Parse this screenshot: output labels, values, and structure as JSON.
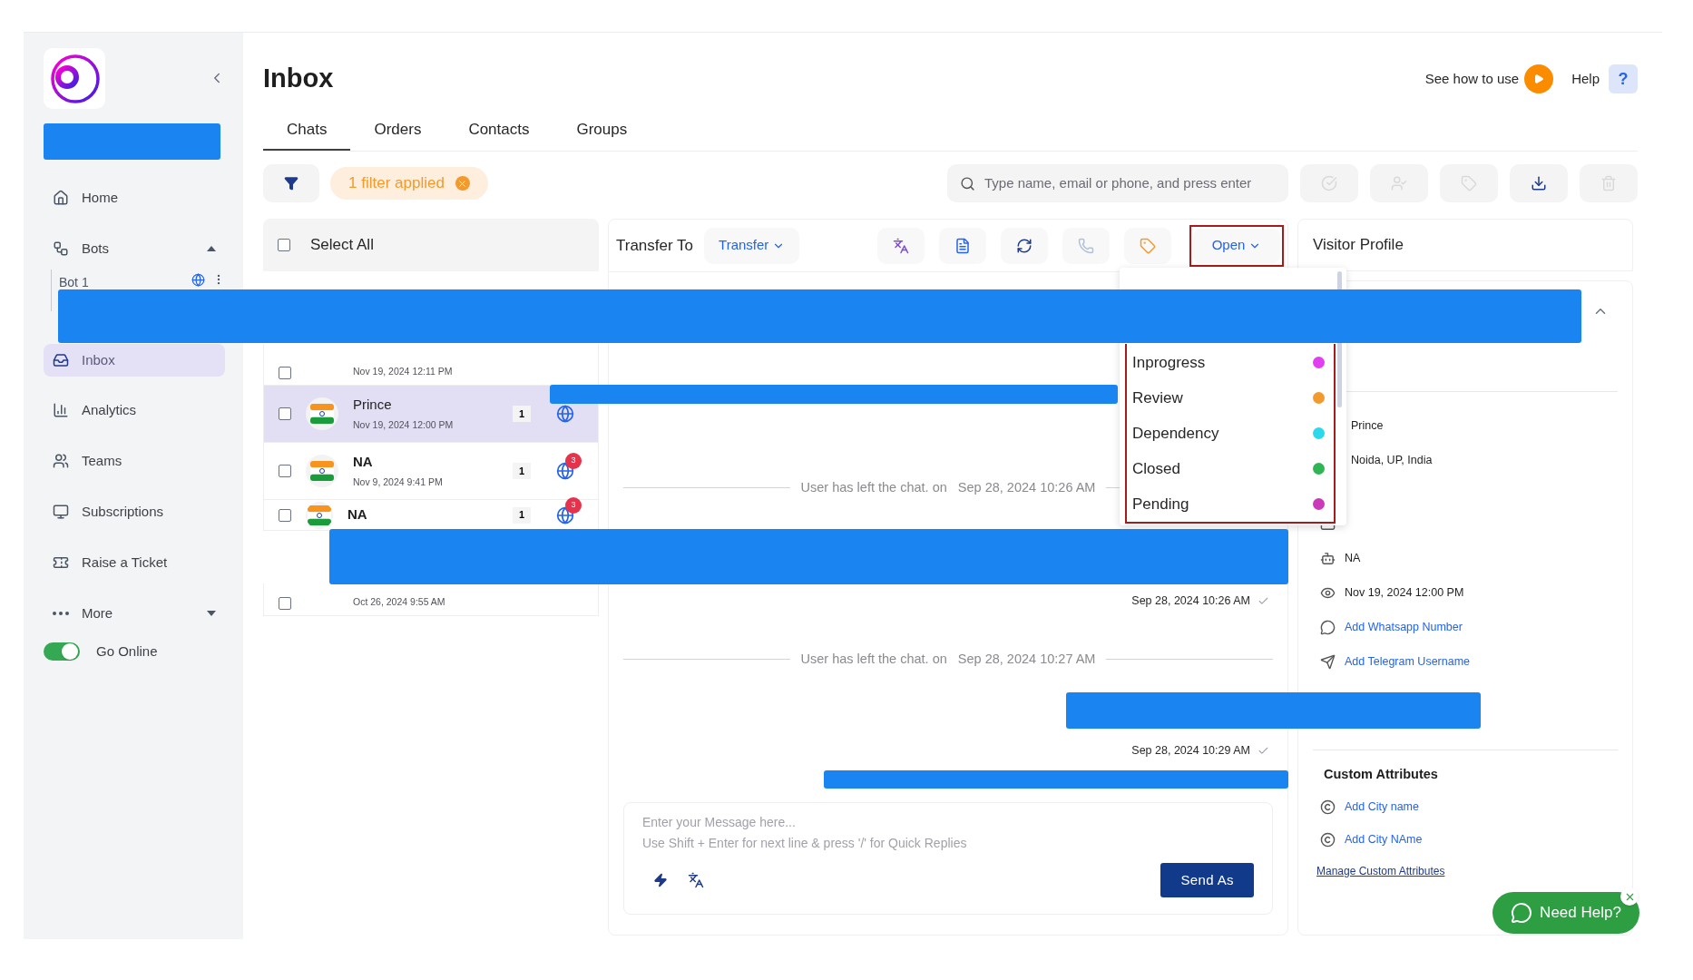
{
  "sidebar": {
    "items": [
      {
        "kind": "home",
        "label": "Home",
        "selected": false
      },
      {
        "kind": "bots",
        "label": "Bots",
        "selected": false,
        "expanded": true
      },
      {
        "kind": "inbox",
        "label": "Inbox",
        "selected": true
      },
      {
        "kind": "analytics",
        "label": "Analytics",
        "selected": false
      },
      {
        "kind": "teams",
        "label": "Teams",
        "selected": false
      },
      {
        "kind": "subscriptions",
        "label": "Subscriptions",
        "selected": false
      },
      {
        "kind": "ticket",
        "label": "Raise a Ticket",
        "selected": false
      },
      {
        "kind": "more",
        "label": "More",
        "selected": false,
        "expanded": false
      }
    ],
    "bot": {
      "label": "Bot 1"
    },
    "go_online": {
      "label": "Go Online",
      "on": true
    }
  },
  "header": {
    "title": "Inbox",
    "how_to": "See how to use",
    "help": "Help",
    "help_icon": "?"
  },
  "tabs": [
    {
      "label": "Chats",
      "selected": true
    },
    {
      "label": "Orders",
      "selected": false
    },
    {
      "label": "Contacts",
      "selected": false
    },
    {
      "label": "Groups",
      "selected": false
    }
  ],
  "filter": {
    "label": "1 filter applied"
  },
  "search": {
    "placeholder": "Type name, email or phone, and press enter"
  },
  "actions": [
    {
      "kind": "resolve",
      "disabled": true
    },
    {
      "kind": "assign",
      "disabled": true
    },
    {
      "kind": "tag",
      "disabled": true
    },
    {
      "kind": "download",
      "disabled": false
    },
    {
      "kind": "delete",
      "disabled": true
    }
  ],
  "chat_list": {
    "select_all": {
      "label": "Select All",
      "checked": false
    },
    "rows": [
      {
        "date": "Nov 19, 2024 12:11 PM",
        "checked": false,
        "selected": false
      },
      {
        "name": "Prince",
        "bold": false,
        "count": "1",
        "date": "Nov 19, 2024 12:00 PM",
        "checked": false,
        "selected": true
      },
      {
        "name": "NA",
        "bold": true,
        "count": "1",
        "alerts": "3",
        "date": "Nov 9, 2024 9:41 PM",
        "checked": false,
        "selected": false
      },
      {
        "name": "NA",
        "bold": true,
        "count": "1",
        "alerts": "3",
        "checked": false,
        "selected": false
      },
      {
        "date": "Oct 26, 2024 9:55 AM",
        "checked": false,
        "selected": false
      }
    ]
  },
  "chat": {
    "transfer_label": "Transfer To",
    "transfer": "Transfer",
    "status": "Open",
    "tools": [
      {
        "kind": "translate",
        "disabled": false
      },
      {
        "kind": "notes",
        "disabled": false
      },
      {
        "kind": "refresh",
        "disabled": false
      },
      {
        "kind": "call",
        "disabled": true
      },
      {
        "kind": "tag",
        "disabled": false
      }
    ],
    "events": [
      {
        "kind": "system",
        "text": "User has left the chat. on",
        "time": "Sep 28, 2024 10:26 AM"
      },
      {
        "kind": "sent",
        "time": "Sep 28, 2024 10:26 AM"
      },
      {
        "kind": "system",
        "text": "User has left the chat. on",
        "time": "Sep 28, 2024 10:27 AM"
      },
      {
        "kind": "sent",
        "time": "Sep 28, 2024 10:29 AM"
      }
    ],
    "composer": {
      "placeholder": "Enter your Message here...\nUse Shift + Enter for next line & press '/' for Quick Replies",
      "send": "Send As"
    }
  },
  "status_menu": {
    "items": [
      {
        "label": "Inprogress",
        "color": "#e040f0"
      },
      {
        "label": "Review",
        "color": "#f29a2e"
      },
      {
        "label": "Dependency",
        "color": "#2ed8ea"
      },
      {
        "label": "Closed",
        "color": "#2fb553"
      },
      {
        "label": "Pending",
        "color": "#c93bb8"
      }
    ]
  },
  "profile": {
    "title": "Visitor Profile",
    "fields": [
      {
        "kind": "name",
        "text": "Prince"
      },
      {
        "kind": "location",
        "text": "Noida, UP, India"
      },
      {
        "kind": "email"
      },
      {
        "kind": "bot",
        "text": "NA"
      },
      {
        "kind": "seen",
        "text": "Nov 19, 2024 12:00 PM"
      },
      {
        "kind": "whatsapp",
        "text": "Add Whatsapp Number",
        "link": true
      },
      {
        "kind": "telegram",
        "text": "Add Telegram Username",
        "link": true
      }
    ],
    "custom_attributes": {
      "title": "Custom Attributes",
      "items": [
        "Add City name",
        "Add City NAme"
      ],
      "manage": "Manage Custom Attributes"
    }
  },
  "help_widget": {
    "label": "Need Help?"
  }
}
